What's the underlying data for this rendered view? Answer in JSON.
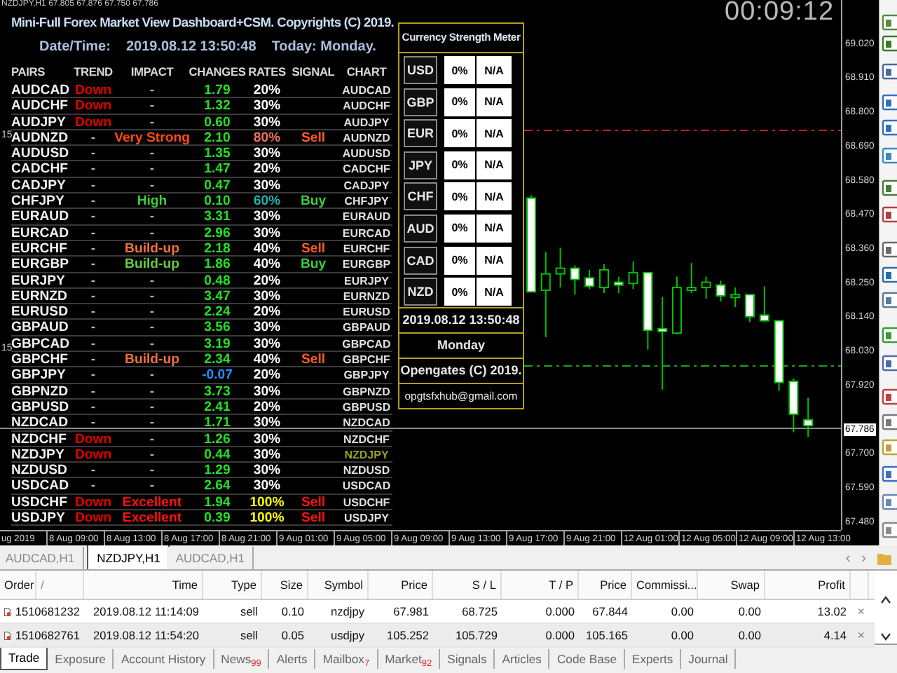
{
  "chart_header": "NZDJPY,H1  67.805 67.876 67.750 67.786",
  "clock": "00:09:12",
  "dashboard": {
    "title": "Mini-Full Forex Market View Dashboard+CSM. Copyrights (C) 2019.",
    "datetime_label": "Date/Time:",
    "datetime": "2019.08.12 13:50:48",
    "today": "Today: Monday.",
    "columns": [
      "PAIRS",
      "TREND",
      "IMPACT",
      "CHANGES",
      "RATES",
      "SIGNAL",
      "CHART"
    ],
    "rows": [
      {
        "pair": "AUDCAD",
        "trend": {
          "text": "Down",
          "color": "#e00000"
        },
        "impact": {
          "text": "-",
          "color": "#b0b0b0"
        },
        "change": {
          "text": "1.79",
          "color": "#22e022"
        },
        "rate": {
          "text": "20%",
          "color": "#ffffff"
        },
        "chart": {
          "text": "AUDCAD",
          "selected": false
        }
      },
      {
        "pair": "AUDCHF",
        "trend": {
          "text": "Down",
          "color": "#e00000"
        },
        "impact": {
          "text": "-",
          "color": "#b0b0b0"
        },
        "change": {
          "text": "1.32",
          "color": "#22e022"
        },
        "rate": {
          "text": "30%",
          "color": "#ffffff"
        },
        "chart": {
          "text": "AUDCHF",
          "selected": false
        }
      },
      {
        "pair": "AUDJPY",
        "trend": {
          "text": "Down",
          "color": "#e00000"
        },
        "impact": {
          "text": "-",
          "color": "#b0b0b0"
        },
        "change": {
          "text": "0.60",
          "color": "#22e022"
        },
        "rate": {
          "text": "30%",
          "color": "#ffffff"
        },
        "chart": {
          "text": "AUDJPY",
          "selected": false
        }
      },
      {
        "pair": "AUDNZD",
        "trend": {
          "text": "-",
          "color": "#b0b0b0"
        },
        "impact": {
          "text": "Very Strong",
          "color": "#ff4a10"
        },
        "change": {
          "text": "2.10",
          "color": "#22e022"
        },
        "rate": {
          "text": "80%",
          "color": "#f07060"
        },
        "signal": {
          "text": "Sell",
          "color": "#ff5a20"
        },
        "chart": {
          "text": "AUDNZD",
          "selected": false
        }
      },
      {
        "pair": "AUDUSD",
        "trend": {
          "text": "-",
          "color": "#b0b0b0"
        },
        "impact": {
          "text": "-",
          "color": "#b0b0b0"
        },
        "change": {
          "text": "1.35",
          "color": "#22e022"
        },
        "rate": {
          "text": "30%",
          "color": "#ffffff"
        },
        "chart": {
          "text": "AUDUSD",
          "selected": false
        }
      },
      {
        "pair": "CADCHF",
        "trend": {
          "text": "-",
          "color": "#b0b0b0"
        },
        "impact": {
          "text": "-",
          "color": "#b0b0b0"
        },
        "change": {
          "text": "1.47",
          "color": "#22e022"
        },
        "rate": {
          "text": "20%",
          "color": "#ffffff"
        },
        "chart": {
          "text": "CADCHF",
          "selected": false
        }
      },
      {
        "pair": "CADJPY",
        "trend": {
          "text": "-",
          "color": "#b0b0b0"
        },
        "impact": {
          "text": "-",
          "color": "#b0b0b0"
        },
        "change": {
          "text": "0.47",
          "color": "#22e022"
        },
        "rate": {
          "text": "30%",
          "color": "#ffffff"
        },
        "chart": {
          "text": "CADJPY",
          "selected": false
        }
      },
      {
        "pair": "CHFJPY",
        "trend": {
          "text": "-",
          "color": "#b0b0b0"
        },
        "impact": {
          "text": "High",
          "color": "#3ccc3c"
        },
        "change": {
          "text": "0.10",
          "color": "#22e022"
        },
        "rate": {
          "text": "60%",
          "color": "#20b2aa"
        },
        "signal": {
          "text": "Buy",
          "color": "#3ccc3c"
        },
        "chart": {
          "text": "CHFJPY",
          "selected": false
        }
      },
      {
        "pair": "EURAUD",
        "trend": {
          "text": "-",
          "color": "#b0b0b0"
        },
        "impact": {
          "text": "-",
          "color": "#b0b0b0"
        },
        "change": {
          "text": "3.31",
          "color": "#22e022"
        },
        "rate": {
          "text": "30%",
          "color": "#ffffff"
        },
        "chart": {
          "text": "EURAUD",
          "selected": false
        }
      },
      {
        "pair": "EURCAD",
        "trend": {
          "text": "-",
          "color": "#b0b0b0"
        },
        "impact": {
          "text": "-",
          "color": "#b0b0b0"
        },
        "change": {
          "text": "2.96",
          "color": "#22e022"
        },
        "rate": {
          "text": "30%",
          "color": "#ffffff"
        },
        "chart": {
          "text": "EURCAD",
          "selected": false
        }
      },
      {
        "pair": "EURCHF",
        "trend": {
          "text": "-",
          "color": "#b0b0b0"
        },
        "impact": {
          "text": "Build-up",
          "color": "#f0703c"
        },
        "change": {
          "text": "2.18",
          "color": "#22e022"
        },
        "rate": {
          "text": "40%",
          "color": "#ffffff"
        },
        "signal": {
          "text": "Sell",
          "color": "#ff5a20"
        },
        "chart": {
          "text": "EURCHF",
          "selected": false
        }
      },
      {
        "pair": "EURGBP",
        "trend": {
          "text": "-",
          "color": "#b0b0b0"
        },
        "impact": {
          "text": "Build-up",
          "color": "#66cc44"
        },
        "change": {
          "text": "1.86",
          "color": "#22e022"
        },
        "rate": {
          "text": "40%",
          "color": "#ffffff"
        },
        "signal": {
          "text": "Buy",
          "color": "#3ccc3c"
        },
        "chart": {
          "text": "EURGBP",
          "selected": false
        }
      },
      {
        "pair": "EURJPY",
        "trend": {
          "text": "-",
          "color": "#b0b0b0"
        },
        "impact": {
          "text": "-",
          "color": "#b0b0b0"
        },
        "change": {
          "text": "0.48",
          "color": "#22e022"
        },
        "rate": {
          "text": "20%",
          "color": "#ffffff"
        },
        "chart": {
          "text": "EURJPY",
          "selected": false
        }
      },
      {
        "pair": "EURNZD",
        "trend": {
          "text": "-",
          "color": "#b0b0b0"
        },
        "impact": {
          "text": "-",
          "color": "#b0b0b0"
        },
        "change": {
          "text": "3.47",
          "color": "#22e022"
        },
        "rate": {
          "text": "30%",
          "color": "#ffffff"
        },
        "chart": {
          "text": "EURNZD",
          "selected": false
        }
      },
      {
        "pair": "EURUSD",
        "trend": {
          "text": "-",
          "color": "#b0b0b0"
        },
        "impact": {
          "text": "-",
          "color": "#b0b0b0"
        },
        "change": {
          "text": "2.24",
          "color": "#22e022"
        },
        "rate": {
          "text": "20%",
          "color": "#ffffff"
        },
        "chart": {
          "text": "EURUSD",
          "selected": false
        }
      },
      {
        "pair": "GBPAUD",
        "trend": {
          "text": "-",
          "color": "#b0b0b0"
        },
        "impact": {
          "text": "-",
          "color": "#b0b0b0"
        },
        "change": {
          "text": "3.56",
          "color": "#22e022"
        },
        "rate": {
          "text": "30%",
          "color": "#ffffff"
        },
        "chart": {
          "text": "GBPAUD",
          "selected": false
        }
      },
      {
        "pair": "GBPCAD",
        "trend": {
          "text": "-",
          "color": "#b0b0b0"
        },
        "impact": {
          "text": "-",
          "color": "#b0b0b0"
        },
        "change": {
          "text": "3.19",
          "color": "#22e022"
        },
        "rate": {
          "text": "30%",
          "color": "#ffffff"
        },
        "chart": {
          "text": "GBPCAD",
          "selected": false
        }
      },
      {
        "pair": "GBPCHF",
        "trend": {
          "text": "-",
          "color": "#b0b0b0"
        },
        "impact": {
          "text": "Build-up",
          "color": "#f0703c"
        },
        "change": {
          "text": "2.34",
          "color": "#22e022"
        },
        "rate": {
          "text": "40%",
          "color": "#ffffff"
        },
        "signal": {
          "text": "Sell",
          "color": "#ff5a20"
        },
        "chart": {
          "text": "GBPCHF",
          "selected": false
        }
      },
      {
        "pair": "GBPJPY",
        "trend": {
          "text": "-",
          "color": "#b0b0b0"
        },
        "impact": {
          "text": "-",
          "color": "#b0b0b0"
        },
        "change": {
          "text": "-0.07",
          "color": "#1e90ff"
        },
        "rate": {
          "text": "20%",
          "color": "#ffffff"
        },
        "chart": {
          "text": "GBPJPY",
          "selected": false
        }
      },
      {
        "pair": "GBPNZD",
        "trend": {
          "text": "-",
          "color": "#b0b0b0"
        },
        "impact": {
          "text": "-",
          "color": "#b0b0b0"
        },
        "change": {
          "text": "3.73",
          "color": "#22e022"
        },
        "rate": {
          "text": "30%",
          "color": "#ffffff"
        },
        "chart": {
          "text": "GBPNZD",
          "selected": false
        }
      },
      {
        "pair": "GBPUSD",
        "trend": {
          "text": "-",
          "color": "#b0b0b0"
        },
        "impact": {
          "text": "-",
          "color": "#b0b0b0"
        },
        "change": {
          "text": "2.41",
          "color": "#22e022"
        },
        "rate": {
          "text": "20%",
          "color": "#ffffff"
        },
        "chart": {
          "text": "GBPUSD",
          "selected": false
        }
      },
      {
        "pair": "NZDCAD",
        "trend": {
          "text": "-",
          "color": "#b0b0b0"
        },
        "impact": {
          "text": "-",
          "color": "#b0b0b0"
        },
        "change": {
          "text": "1.71",
          "color": "#22e022"
        },
        "rate": {
          "text": "30%",
          "color": "#ffffff"
        },
        "chart": {
          "text": "NZDCAD",
          "selected": false
        }
      },
      {
        "pair": "NZDCHF",
        "trend": {
          "text": "Down",
          "color": "#e00000"
        },
        "impact": {
          "text": "-",
          "color": "#b0b0b0"
        },
        "change": {
          "text": "1.26",
          "color": "#22e022"
        },
        "rate": {
          "text": "30%",
          "color": "#ffffff"
        },
        "chart": {
          "text": "NZDCHF",
          "selected": false
        }
      },
      {
        "pair": "NZDJPY",
        "trend": {
          "text": "Down",
          "color": "#e00000"
        },
        "impact": {
          "text": "-",
          "color": "#b0b0b0"
        },
        "change": {
          "text": "0.44",
          "color": "#22e022"
        },
        "rate": {
          "text": "30%",
          "color": "#ffffff"
        },
        "chart": {
          "text": "NZDJPY",
          "selected": true
        }
      },
      {
        "pair": "NZDUSD",
        "trend": {
          "text": "-",
          "color": "#b0b0b0"
        },
        "impact": {
          "text": "-",
          "color": "#b0b0b0"
        },
        "change": {
          "text": "1.29",
          "color": "#22e022"
        },
        "rate": {
          "text": "30%",
          "color": "#ffffff"
        },
        "chart": {
          "text": "NZDUSD",
          "selected": false
        }
      },
      {
        "pair": "USDCAD",
        "trend": {
          "text": "-",
          "color": "#b0b0b0"
        },
        "impact": {
          "text": "-",
          "color": "#b0b0b0"
        },
        "change": {
          "text": "2.64",
          "color": "#22e022"
        },
        "rate": {
          "text": "30%",
          "color": "#ffffff"
        },
        "chart": {
          "text": "USDCAD",
          "selected": false
        }
      },
      {
        "pair": "USDCHF",
        "trend": {
          "text": "Down",
          "color": "#e00000"
        },
        "impact": {
          "text": "Excellent",
          "color": "#ff1010"
        },
        "change": {
          "text": "1.94",
          "color": "#22e022"
        },
        "rate": {
          "text": "100%",
          "color": "#ffff00"
        },
        "signal": {
          "text": "Sell",
          "color": "#ff1010"
        },
        "chart": {
          "text": "USDCHF",
          "selected": false
        }
      },
      {
        "pair": "USDJPY",
        "trend": {
          "text": "Down",
          "color": "#e00000"
        },
        "impact": {
          "text": "Excellent",
          "color": "#ff1010"
        },
        "change": {
          "text": "0.39",
          "color": "#22e022"
        },
        "rate": {
          "text": "100%",
          "color": "#ffff00"
        },
        "signal": {
          "text": "Sell",
          "color": "#ff1010"
        },
        "chart": {
          "text": "USDJPY",
          "selected": false
        }
      }
    ]
  },
  "csm": {
    "title": "Currency Strength Meter",
    "currencies": [
      {
        "code": "USD",
        "strength": "0%",
        "status": "N/A"
      },
      {
        "code": "GBP",
        "strength": "0%",
        "status": "N/A"
      },
      {
        "code": "EUR",
        "strength": "0%",
        "status": "N/A"
      },
      {
        "code": "JPY",
        "strength": "0%",
        "status": "N/A"
      },
      {
        "code": "CHF",
        "strength": "0%",
        "status": "N/A"
      },
      {
        "code": "AUD",
        "strength": "0%",
        "status": "N/A"
      },
      {
        "code": "CAD",
        "strength": "0%",
        "status": "N/A"
      },
      {
        "code": "NZD",
        "strength": "0%",
        "status": "N/A"
      }
    ],
    "datetime": "2019.08.12 13:50:48",
    "day": "Monday",
    "copyright": "Opengates (C) 2019.",
    "email": "opgtsfxhub@gmail.com"
  },
  "chart": {
    "chart_data": {
      "type": "candlestick",
      "categories": [
        null,
        null,
        null,
        null,
        null,
        null,
        null,
        null,
        null,
        null,
        null,
        null,
        null,
        null,
        null,
        null,
        null,
        null,
        null,
        null
      ],
      "ylim": [
        67.45,
        69.157
      ],
      "yticks": [
        {
          "value": 69.02,
          "label": "69.020"
        },
        {
          "value": 68.91,
          "label": "68.910"
        },
        {
          "value": 68.8,
          "label": "68.800"
        },
        {
          "value": 68.69,
          "label": "68.690"
        },
        {
          "value": 68.58,
          "label": "68.580"
        },
        {
          "value": 68.47,
          "label": "68.470"
        },
        {
          "value": 68.36,
          "label": "68.360"
        },
        {
          "value": 68.25,
          "label": "68.250"
        },
        {
          "value": 68.14,
          "label": "68.140"
        },
        {
          "value": 68.03,
          "label": "68.030"
        },
        {
          "value": 67.92,
          "label": "67.920"
        },
        {
          "value": 67.7,
          "label": "67.700"
        },
        {
          "value": 67.59,
          "label": "67.590"
        },
        {
          "value": 67.48,
          "label": "67.480"
        }
      ],
      "ohlc": [
        [
          68.519,
          68.528,
          68.217,
          68.217
        ],
        [
          68.222,
          68.346,
          68.071,
          68.275
        ],
        [
          68.275,
          68.359,
          68.231,
          68.293
        ],
        [
          68.293,
          68.302,
          68.208,
          68.257
        ],
        [
          68.262,
          68.288,
          68.226,
          68.235
        ],
        [
          68.231,
          68.306,
          68.213,
          68.288
        ],
        [
          68.248,
          68.266,
          68.213,
          68.239
        ],
        [
          68.244,
          68.315,
          68.226,
          68.279
        ],
        [
          68.279,
          68.279,
          68.031,
          68.093
        ],
        [
          68.098,
          68.2,
          67.902,
          68.089
        ],
        [
          68.084,
          68.266,
          68.08,
          68.231
        ],
        [
          68.222,
          68.31,
          68.213,
          68.231
        ],
        [
          68.231,
          68.266,
          68.195,
          68.248
        ],
        [
          68.239,
          68.253,
          68.186,
          68.204
        ],
        [
          68.2,
          68.231,
          68.168,
          68.208
        ],
        [
          68.208,
          68.208,
          68.12,
          68.137
        ],
        [
          68.142,
          68.235,
          68.12,
          68.124
        ],
        [
          68.124,
          68.124,
          67.898,
          67.925
        ],
        [
          67.929,
          67.938,
          67.765,
          67.823
        ],
        [
          67.805,
          67.876,
          67.75,
          67.786
        ]
      ]
    }
  },
  "left_scale": [
    "15",
    "15"
  ],
  "current_price": "67.786",
  "time_axis": [
    "ug 2019",
    "8 Aug 09:00",
    "8 Aug 13:00",
    "8 Aug 17:00",
    "8 Aug 21:00",
    "9 Aug 01:00",
    "9 Aug 05:00",
    "9 Aug 09:00",
    "9 Aug 13:00",
    "9 Aug 17:00",
    "9 Aug 21:00",
    "12 Aug 01:00",
    "12 Aug 05:00",
    "12 Aug 09:00",
    "12 Aug 13:00"
  ],
  "chart_tabs": [
    {
      "label": "AUDCAD,H1",
      "selected": false
    },
    {
      "label": "NZDJPY,H1",
      "selected": true
    },
    {
      "label": "AUDCAD,H1",
      "selected": false
    }
  ],
  "tab_scroll": [
    "‹",
    "›"
  ],
  "orders": {
    "columns": [
      "Order",
      "/",
      "Time",
      "Type",
      "Size",
      "Symbol",
      "Price",
      "S / L",
      "T / P",
      "Price",
      "Commissi...",
      "Swap",
      "Profit"
    ],
    "rows": [
      {
        "order": "1510681232",
        "time": "2019.08.12 11:14:09",
        "type": "sell",
        "size": "0.10",
        "symbol": "nzdjpy",
        "open_price": "67.981",
        "sl": "68.725",
        "tp": "0.000",
        "price": "67.844",
        "commission": "0.00",
        "swap": "0.00",
        "profit": "13.02",
        "close": "×"
      },
      {
        "order": "1510682761",
        "time": "2019.08.12 11:54:20",
        "type": "sell",
        "size": "0.05",
        "symbol": "usdjpy",
        "open_price": "105.252",
        "sl": "105.729",
        "tp": "0.000",
        "price": "105.165",
        "commission": "0.00",
        "swap": "0.00",
        "profit": "4.14",
        "close": "×"
      }
    ]
  },
  "terminal_tabs": [
    {
      "label": "Trade",
      "selected": true
    },
    {
      "label": "Exposure",
      "selected": false
    },
    {
      "label": "Account History",
      "selected": false
    },
    {
      "label": "News",
      "badge": "99",
      "selected": false
    },
    {
      "label": "Alerts",
      "selected": false
    },
    {
      "label": "Mailbox",
      "badge": "7",
      "selected": false
    },
    {
      "label": "Market",
      "badge": "92",
      "selected": false
    },
    {
      "label": "Signals",
      "selected": false
    },
    {
      "label": "Articles",
      "selected": false
    },
    {
      "label": "Code Base",
      "selected": false
    },
    {
      "label": "Experts",
      "selected": false
    },
    {
      "label": "Journal",
      "selected": false
    }
  ]
}
